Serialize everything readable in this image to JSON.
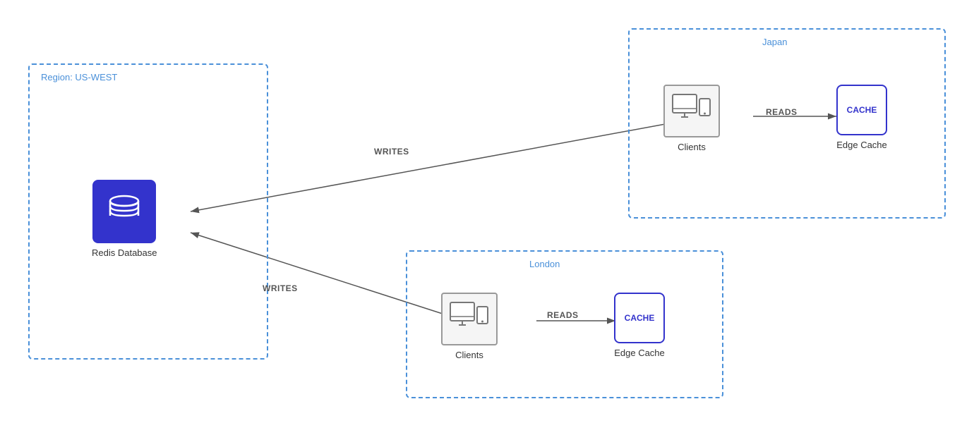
{
  "regions": {
    "uswest": {
      "label": "Region: US-WEST",
      "node": "Redis Database"
    },
    "japan": {
      "label": "Japan",
      "clients_label": "Clients",
      "cache_label": "Edge Cache",
      "cache_text": "CACHE"
    },
    "london": {
      "label": "London",
      "clients_label": "Clients",
      "cache_label": "Edge Cache",
      "cache_text": "CACHE"
    }
  },
  "arrows": {
    "writes_japan": "WRITES",
    "reads_japan": "READS",
    "writes_london": "WRITES",
    "reads_london": "READS"
  }
}
